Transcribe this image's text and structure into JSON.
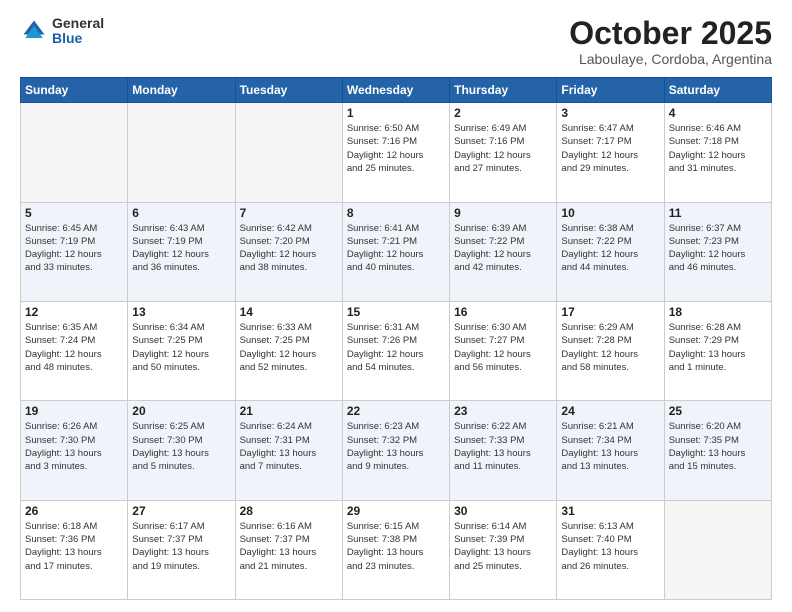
{
  "header": {
    "logo_general": "General",
    "logo_blue": "Blue",
    "month": "October 2025",
    "location": "Laboulaye, Cordoba, Argentina"
  },
  "days_of_week": [
    "Sunday",
    "Monday",
    "Tuesday",
    "Wednesday",
    "Thursday",
    "Friday",
    "Saturday"
  ],
  "weeks": [
    [
      {
        "day": "",
        "info": ""
      },
      {
        "day": "",
        "info": ""
      },
      {
        "day": "",
        "info": ""
      },
      {
        "day": "1",
        "info": "Sunrise: 6:50 AM\nSunset: 7:16 PM\nDaylight: 12 hours\nand 25 minutes."
      },
      {
        "day": "2",
        "info": "Sunrise: 6:49 AM\nSunset: 7:16 PM\nDaylight: 12 hours\nand 27 minutes."
      },
      {
        "day": "3",
        "info": "Sunrise: 6:47 AM\nSunset: 7:17 PM\nDaylight: 12 hours\nand 29 minutes."
      },
      {
        "day": "4",
        "info": "Sunrise: 6:46 AM\nSunset: 7:18 PM\nDaylight: 12 hours\nand 31 minutes."
      }
    ],
    [
      {
        "day": "5",
        "info": "Sunrise: 6:45 AM\nSunset: 7:19 PM\nDaylight: 12 hours\nand 33 minutes."
      },
      {
        "day": "6",
        "info": "Sunrise: 6:43 AM\nSunset: 7:19 PM\nDaylight: 12 hours\nand 36 minutes."
      },
      {
        "day": "7",
        "info": "Sunrise: 6:42 AM\nSunset: 7:20 PM\nDaylight: 12 hours\nand 38 minutes."
      },
      {
        "day": "8",
        "info": "Sunrise: 6:41 AM\nSunset: 7:21 PM\nDaylight: 12 hours\nand 40 minutes."
      },
      {
        "day": "9",
        "info": "Sunrise: 6:39 AM\nSunset: 7:22 PM\nDaylight: 12 hours\nand 42 minutes."
      },
      {
        "day": "10",
        "info": "Sunrise: 6:38 AM\nSunset: 7:22 PM\nDaylight: 12 hours\nand 44 minutes."
      },
      {
        "day": "11",
        "info": "Sunrise: 6:37 AM\nSunset: 7:23 PM\nDaylight: 12 hours\nand 46 minutes."
      }
    ],
    [
      {
        "day": "12",
        "info": "Sunrise: 6:35 AM\nSunset: 7:24 PM\nDaylight: 12 hours\nand 48 minutes."
      },
      {
        "day": "13",
        "info": "Sunrise: 6:34 AM\nSunset: 7:25 PM\nDaylight: 12 hours\nand 50 minutes."
      },
      {
        "day": "14",
        "info": "Sunrise: 6:33 AM\nSunset: 7:25 PM\nDaylight: 12 hours\nand 52 minutes."
      },
      {
        "day": "15",
        "info": "Sunrise: 6:31 AM\nSunset: 7:26 PM\nDaylight: 12 hours\nand 54 minutes."
      },
      {
        "day": "16",
        "info": "Sunrise: 6:30 AM\nSunset: 7:27 PM\nDaylight: 12 hours\nand 56 minutes."
      },
      {
        "day": "17",
        "info": "Sunrise: 6:29 AM\nSunset: 7:28 PM\nDaylight: 12 hours\nand 58 minutes."
      },
      {
        "day": "18",
        "info": "Sunrise: 6:28 AM\nSunset: 7:29 PM\nDaylight: 13 hours\nand 1 minute."
      }
    ],
    [
      {
        "day": "19",
        "info": "Sunrise: 6:26 AM\nSunset: 7:30 PM\nDaylight: 13 hours\nand 3 minutes."
      },
      {
        "day": "20",
        "info": "Sunrise: 6:25 AM\nSunset: 7:30 PM\nDaylight: 13 hours\nand 5 minutes."
      },
      {
        "day": "21",
        "info": "Sunrise: 6:24 AM\nSunset: 7:31 PM\nDaylight: 13 hours\nand 7 minutes."
      },
      {
        "day": "22",
        "info": "Sunrise: 6:23 AM\nSunset: 7:32 PM\nDaylight: 13 hours\nand 9 minutes."
      },
      {
        "day": "23",
        "info": "Sunrise: 6:22 AM\nSunset: 7:33 PM\nDaylight: 13 hours\nand 11 minutes."
      },
      {
        "day": "24",
        "info": "Sunrise: 6:21 AM\nSunset: 7:34 PM\nDaylight: 13 hours\nand 13 minutes."
      },
      {
        "day": "25",
        "info": "Sunrise: 6:20 AM\nSunset: 7:35 PM\nDaylight: 13 hours\nand 15 minutes."
      }
    ],
    [
      {
        "day": "26",
        "info": "Sunrise: 6:18 AM\nSunset: 7:36 PM\nDaylight: 13 hours\nand 17 minutes."
      },
      {
        "day": "27",
        "info": "Sunrise: 6:17 AM\nSunset: 7:37 PM\nDaylight: 13 hours\nand 19 minutes."
      },
      {
        "day": "28",
        "info": "Sunrise: 6:16 AM\nSunset: 7:37 PM\nDaylight: 13 hours\nand 21 minutes."
      },
      {
        "day": "29",
        "info": "Sunrise: 6:15 AM\nSunset: 7:38 PM\nDaylight: 13 hours\nand 23 minutes."
      },
      {
        "day": "30",
        "info": "Sunrise: 6:14 AM\nSunset: 7:39 PM\nDaylight: 13 hours\nand 25 minutes."
      },
      {
        "day": "31",
        "info": "Sunrise: 6:13 AM\nSunset: 7:40 PM\nDaylight: 13 hours\nand 26 minutes."
      },
      {
        "day": "",
        "info": ""
      }
    ]
  ]
}
